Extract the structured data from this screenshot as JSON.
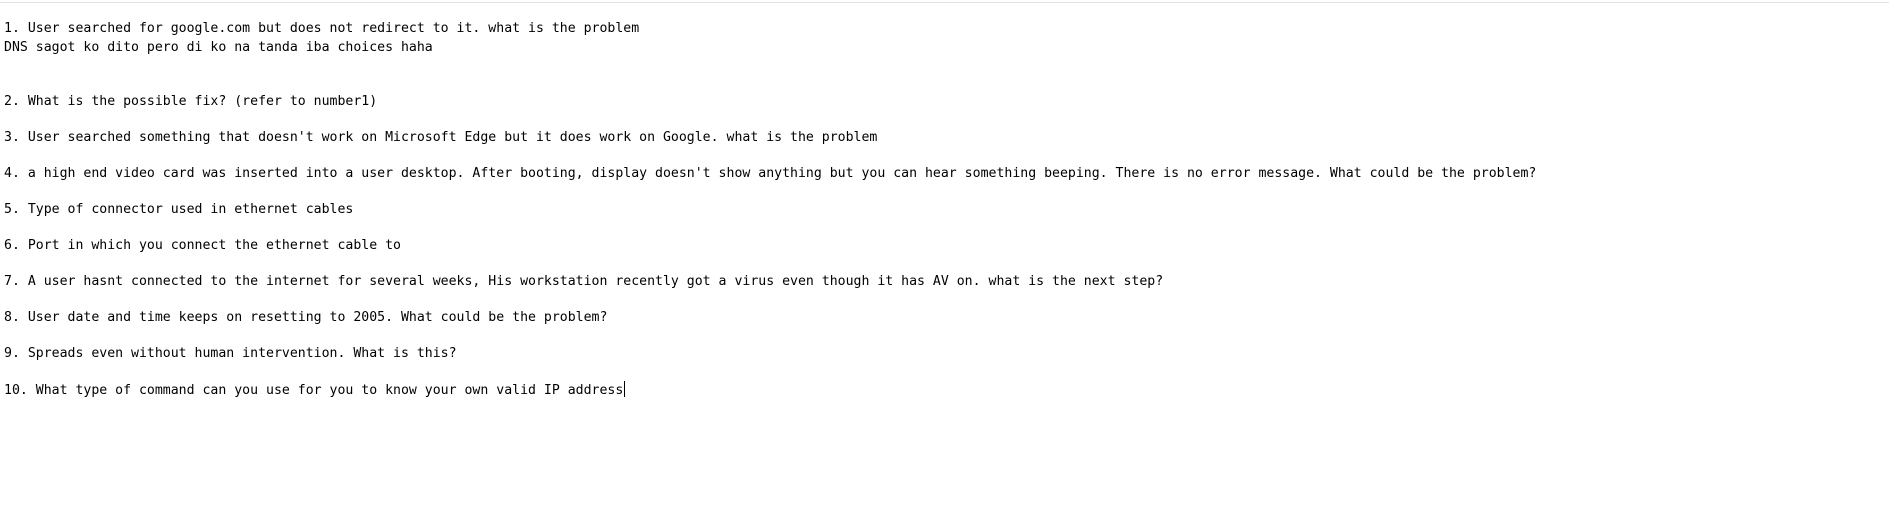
{
  "document": {
    "lines": [
      "1. User searched for google.com but does not redirect to it. what is the problem",
      "DNS sagot ko dito pero di ko na tanda iba choices haha",
      "2. What is the possible fix? (refer to number1)",
      "3. User searched something that doesn't work on Microsoft Edge but it does work on Google. what is the problem",
      "4. a high end video card was inserted into a user desktop. After booting, display doesn't show anything but you can hear something beeping. There is no error message. What could be the problem?",
      "5. Type of connector used in ethernet cables",
      "6. Port in which you connect the ethernet cable to",
      "7. A user hasnt connected to the internet for several weeks, His workstation recently got a virus even though it has AV on. what is the next step?",
      "8. User date and time keeps on resetting to 2005. What could be the problem?",
      "9. Spreads even without human intervention. What is this?",
      "10. What type of command can you use for you to know your own valid IP address"
    ]
  }
}
